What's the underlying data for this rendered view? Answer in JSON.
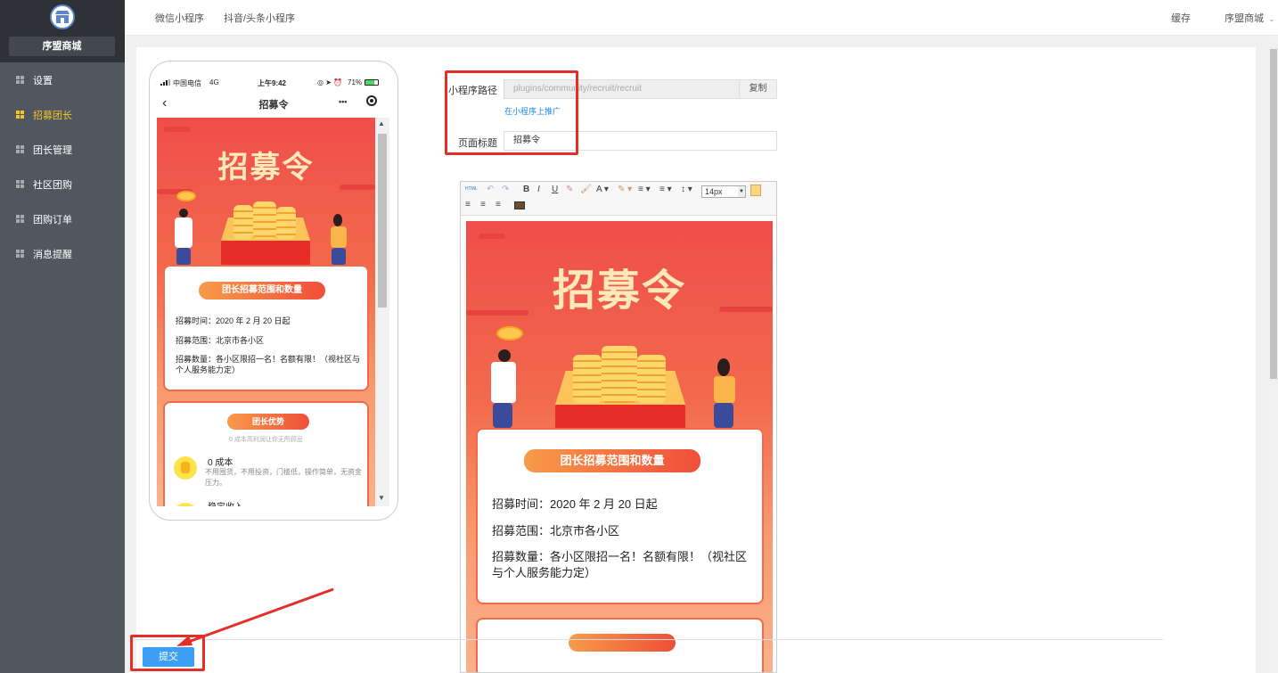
{
  "sidebar": {
    "brand_name": "序盟商城",
    "items": [
      {
        "label": "设置"
      },
      {
        "label": "招募团长"
      },
      {
        "label": "团长管理"
      },
      {
        "label": "社区团购"
      },
      {
        "label": "团购订单"
      },
      {
        "label": "消息提醒"
      }
    ],
    "active_color": "#f4c22b"
  },
  "topbar": {
    "tabs": [
      "微信小程序",
      "抖音/头条小程序"
    ],
    "cache": "缓存",
    "store": "序盟商城"
  },
  "phone": {
    "carrier": "中国电信",
    "network": "4G",
    "time": "上午9:42",
    "battery": "71%",
    "title": "招募令",
    "more": "•••"
  },
  "poster": {
    "title": "招募令",
    "section1_title": "团长招募范围和数量",
    "line1": "招募时间：2020 年 2 月 20 日起",
    "line2": "招募范围：北京市各小区",
    "line3": "招募数量：各小区限招一名！名额有限！（视社区与个人服务能力定）",
    "section2_title": "团长优势",
    "section2_sub": "0 成本高利润让你无所顾忌",
    "adv1_title": "0 成本",
    "adv1_desc": "不用囤货，不用投资，门槛低，操作简单，无资金压力。",
    "adv2_title": "稳定收入"
  },
  "form": {
    "path_label": "小程序路径",
    "path_value": "plugins/community/recruit/recruit",
    "copy_label": "复制",
    "promote_link": "在小程序上推广",
    "title_label": "页面标题",
    "title_value": "招募令"
  },
  "editor": {
    "font_size": "14px",
    "html_label": "HTML"
  },
  "submit_label": "提交",
  "colors": {
    "sidebar_bg": "#50575e",
    "accent_blue": "#3d9ef5",
    "highlight_red": "#e52e27"
  }
}
